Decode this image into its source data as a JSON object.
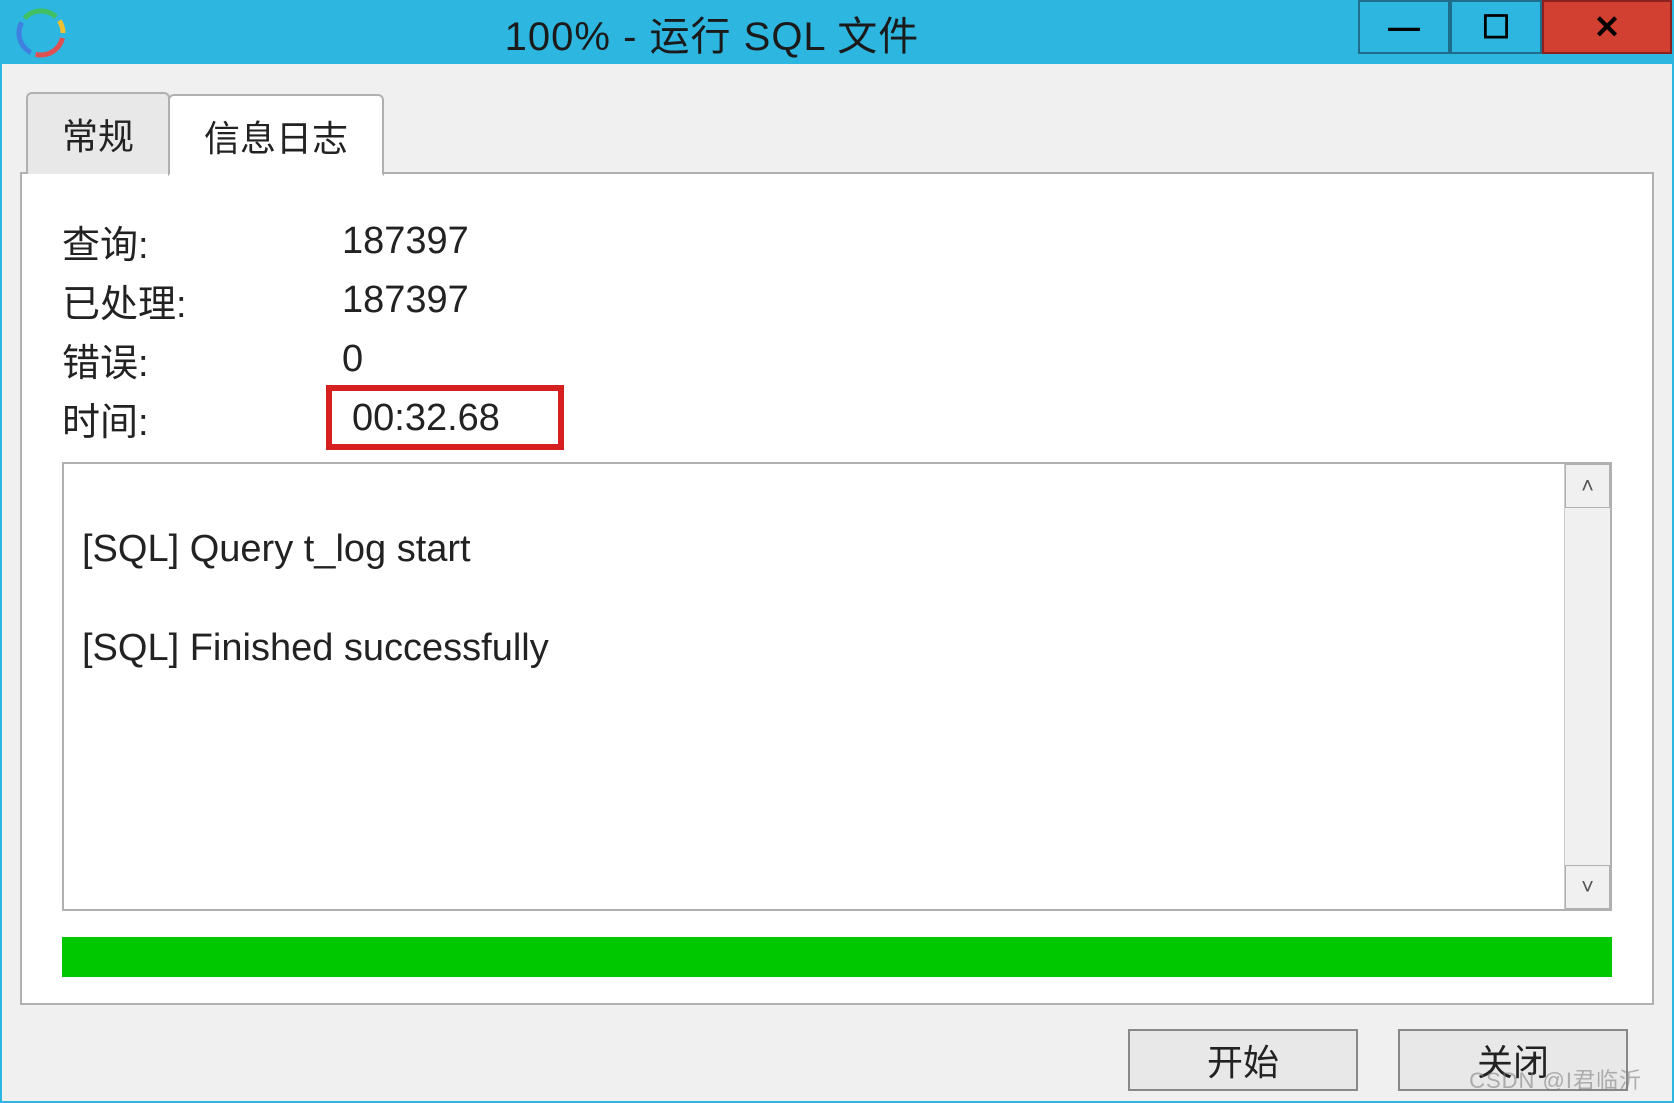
{
  "titlebar": {
    "title": "100% - 运行 SQL 文件"
  },
  "tabs": {
    "general": "常规",
    "log": "信息日志"
  },
  "stats": {
    "query_label": "查询:",
    "query_value": "187397",
    "processed_label": "已处理:",
    "processed_value": "187397",
    "error_label": "错误:",
    "error_value": "0",
    "time_label": "时间:",
    "time_value": "00:32.68"
  },
  "log": {
    "line1": "[SQL] Query t_log start",
    "line2": "[SQL] Finished successfully"
  },
  "buttons": {
    "start": "开始",
    "close": "关闭"
  },
  "watermark": "CSDN @I君临沂"
}
